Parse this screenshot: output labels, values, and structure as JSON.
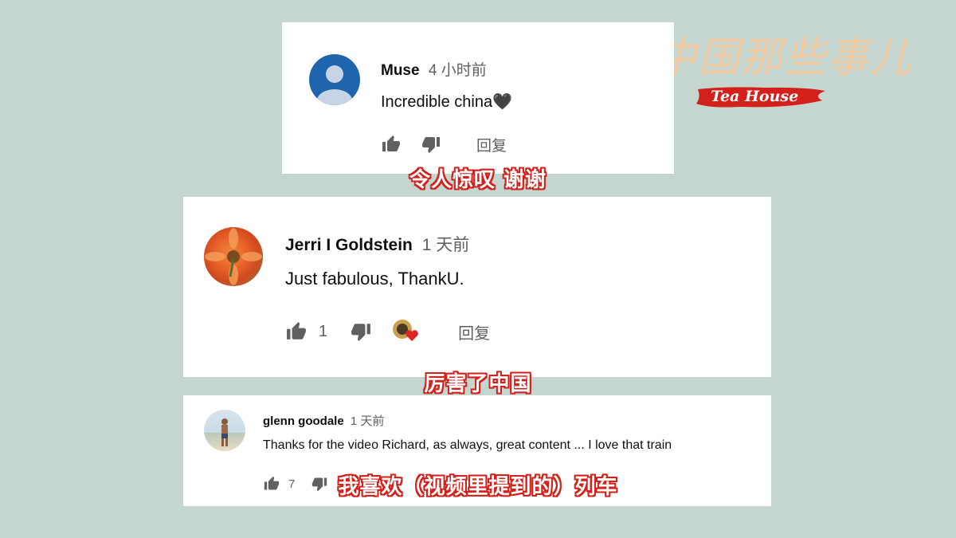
{
  "logo": {
    "cn": "中国那些事儿",
    "en": "Tea House"
  },
  "comments": [
    {
      "author": "Muse",
      "time": "4 小时前",
      "text": "Incredible china🖤",
      "likes": "",
      "reply": "回复",
      "subtitle": "令人惊叹 谢谢"
    },
    {
      "author": "Jerri I Goldstein",
      "time": "1 天前",
      "text": "Just fabulous, ThankU.",
      "likes": "1",
      "reply": "回复",
      "subtitle": "厉害了中国"
    },
    {
      "author": "glenn goodale",
      "time": "1 天前",
      "text": "Thanks for the video Richard, as always, great content ... I love that train",
      "likes": "7",
      "reply": "",
      "subtitle": "我喜欢（视频里提到的）列车"
    }
  ],
  "colors": {
    "background": "#c5d6d1",
    "subtitle_outline": "#d3201b",
    "logo_banner": "#d3201b"
  }
}
